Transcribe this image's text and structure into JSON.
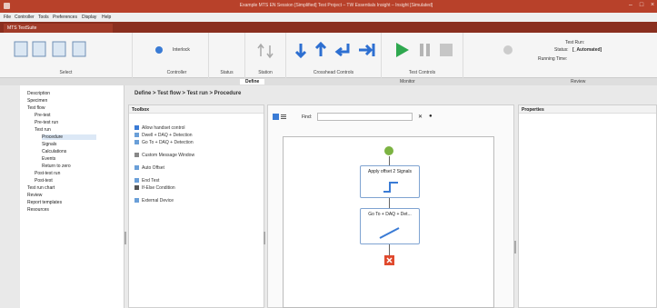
{
  "titlebar": {
    "title": "Example MTS EN Session [Simplified] Test Project – TW Essentials Insight – Insight [Simulated]"
  },
  "menu": [
    "File",
    "Controller",
    "Tools",
    "Preferences",
    "Display",
    "Help"
  ],
  "subtitle": {
    "tab_label": "MTS TestSuite"
  },
  "ribbon": {
    "controller_label": "Controller",
    "interlock_label": "Interlock",
    "status_label": "Status",
    "station_label": "Station",
    "crosshead_label": "Crosshead Controls",
    "test_controls_label": "Test Controls",
    "testrun_label": "Test Run:",
    "status_text_label": "Status:",
    "status_value": "[_Automated]",
    "running_time_label": "Running Time:"
  },
  "section_tabs": [
    "Select",
    "Define",
    "Monitor",
    "Review"
  ],
  "tree": [
    "Description",
    "Specimen",
    "Test flow",
    "Pre-test",
    "Pre-test run",
    "Test run",
    "Procedure",
    "Signals",
    "Calculations",
    "Events",
    "Return to zero",
    "Post-test run",
    "Post-test",
    "Test run chart",
    "Review",
    "Report templates",
    "Resources"
  ],
  "breadcrumb": "Define > Test flow > Test run > Procedure",
  "toolbox": {
    "header": "Toolbox",
    "items": [
      "Allow handset control",
      "Dwell + DAQ + Detection",
      "Go To + DAQ + Detection",
      "Custom Message Window",
      "Auto Offset",
      "End Test",
      "If-Else Condition",
      "External Device"
    ]
  },
  "canvas": {
    "find_label": "Find:",
    "find_value": ""
  },
  "properties": {
    "header": "Properties"
  },
  "flow": {
    "node1": "Apply offset 2 Signals",
    "node2": "Go To + DAQ + Det..."
  }
}
